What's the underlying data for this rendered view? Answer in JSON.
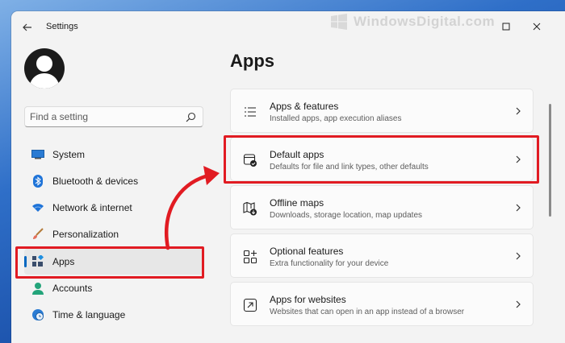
{
  "window": {
    "title": "Settings"
  },
  "watermark": {
    "text": "WindowsDigital.com"
  },
  "search": {
    "placeholder": "Find a setting"
  },
  "sidebar": {
    "items": [
      {
        "label": "System",
        "icon": "monitor-icon"
      },
      {
        "label": "Bluetooth & devices",
        "icon": "bluetooth-icon"
      },
      {
        "label": "Network & internet",
        "icon": "wifi-icon"
      },
      {
        "label": "Personalization",
        "icon": "brush-icon"
      },
      {
        "label": "Apps",
        "icon": "apps-icon",
        "selected": true
      },
      {
        "label": "Accounts",
        "icon": "person-icon"
      },
      {
        "label": "Time & language",
        "icon": "globe-clock-icon"
      }
    ]
  },
  "main": {
    "title": "Apps",
    "cards": [
      {
        "title": "Apps & features",
        "description": "Installed apps, app execution aliases",
        "icon": "list-icon"
      },
      {
        "title": "Default apps",
        "description": "Defaults for file and link types, other defaults",
        "icon": "default-apps-icon"
      },
      {
        "title": "Offline maps",
        "description": "Downloads, storage location, map updates",
        "icon": "map-download-icon"
      },
      {
        "title": "Optional features",
        "description": "Extra functionality for your device",
        "icon": "add-feature-icon"
      },
      {
        "title": "Apps for websites",
        "description": "Websites that can open in an app instead of a browser",
        "icon": "open-in-app-icon"
      }
    ]
  },
  "colors": {
    "accent": "#0067c0",
    "highlight": "#e11b22"
  }
}
